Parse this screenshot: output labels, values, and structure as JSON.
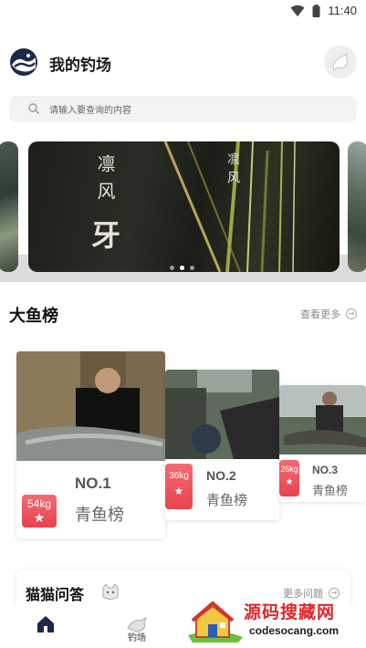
{
  "status_bar": {
    "time": "11:40",
    "wifi_icon": "wifi-icon",
    "battery_icon": "battery-icon"
  },
  "header": {
    "title": "我的钓场",
    "logo_icon": "wave-fish-logo",
    "avatar_icon": "fish-avatar-icon"
  },
  "search": {
    "placeholder": "请输入要查询的内容",
    "icon": "search-icon"
  },
  "banner": {
    "calligraphy_left": "凛风",
    "calligraphy_main": "牙",
    "calligraphy_right": "凛风",
    "dots_total": 3,
    "active_dot": 2
  },
  "big_fish": {
    "title": "大鱼榜",
    "more": "查看更多",
    "ranks": [
      {
        "weight": "54kg",
        "rank": "NO.1",
        "name": "青鱼榜"
      },
      {
        "weight": "36kg",
        "rank": "NO.2",
        "name": "青鱼榜"
      },
      {
        "weight": "26kg",
        "rank": "NO.3",
        "name": "青鱼榜"
      }
    ]
  },
  "qa": {
    "title": "猫猫问答",
    "more": "更多问题",
    "icon": "cat-icon"
  },
  "tabbar": {
    "items": [
      {
        "label": "",
        "icon": "home-icon",
        "active": true
      },
      {
        "label": "钓场",
        "icon": "fishing-spot-icon",
        "active": false
      }
    ]
  },
  "watermark": {
    "text": "源码搜藏网",
    "sub": "codesocang.com"
  },
  "colors": {
    "accent": "#e8434d",
    "brand_navy": "#1c2a4a",
    "text": "#222222"
  }
}
